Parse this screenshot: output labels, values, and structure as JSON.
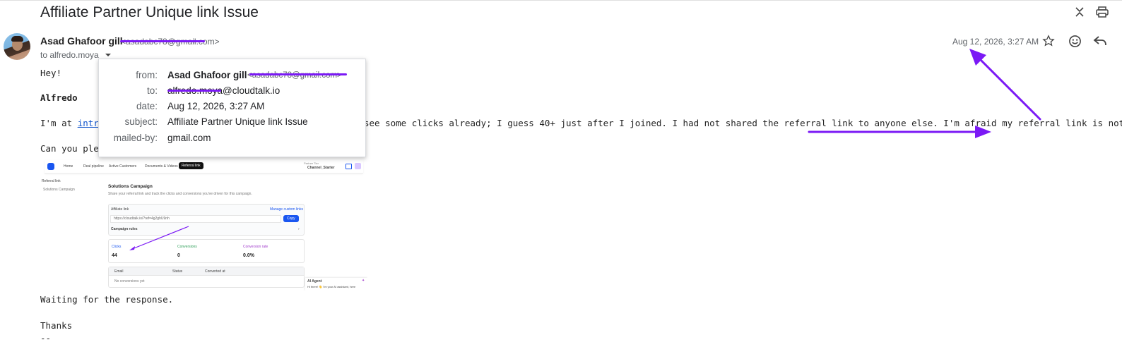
{
  "email": {
    "subject": "Affiliate Partner Unique link Issue",
    "sender_name": "Asad Ghafoor gill",
    "sender_email": "<asadabc78@gmail.com>",
    "to_line": "to alfredo.moya",
    "date": "Aug 12, 2026, 3:27 AM"
  },
  "details_popup": {
    "from_label": "from:",
    "from_name": "Asad Ghafoor gill",
    "from_email": "<asadabc78@gmail.com>",
    "to_label": "to:",
    "to_user": "alfredo.moya",
    "to_domain": "@cloudtalk.io",
    "date_label": "date:",
    "date_value": "Aug 12, 2026, 3:27 AM",
    "subject_label": "subject:",
    "subject_value": "Affiliate Partner Unique link Issue",
    "mailed_by_label": "mailed-by:",
    "mailed_by_value": "gmail.com"
  },
  "body": {
    "greeting": "Hey!",
    "name": "Alfredo",
    "para1_prefix": "I'm at ",
    "para1_link": "introw.",
    "para1_suffix": "see some clicks already; I guess 40+ just after I joined. I had not shared the referral link to anyone else. I'm afraid my referral link is not unique.",
    "para2_prefix": "Can you pleas",
    "waiting": "Waiting for the response.",
    "thanks": "Thanks",
    "sig": "--"
  },
  "embedded_screenshot": {
    "nav": [
      "Home",
      "Deal pipeline",
      "Active Customers",
      "Documents & Videos",
      "Referral link"
    ],
    "active_nav": "Referral link",
    "partner_label": "Partner Tier",
    "partner_name": "Channel_Starter",
    "sidebar_title": "Referral link",
    "sidebar_item": "Solutions Campaign",
    "campaign_title": "Solutions Campaign",
    "campaign_desc": "Share your referral link and track the clicks and conversions you've driven for this campaign.",
    "affiliate_link_label": "Affiliate link",
    "manage_links": "Manage custom links",
    "link_value": "https://cloudtalk.io/?ref=4g2ghU9nh",
    "copy_label": "Copy",
    "campaign_rules": "Campaign rules",
    "stats": [
      {
        "label": "Clicks",
        "value": "44"
      },
      {
        "label": "Conversions",
        "value": "0"
      },
      {
        "label": "Conversion rate",
        "value": "0.0%"
      }
    ],
    "table_headers": [
      "Email",
      "Status",
      "Converted at"
    ],
    "empty_text": "No conversions yet",
    "ai_title": "AI Agent",
    "ai_text": "Hi there! 👋 I'm your AI assistant, here"
  },
  "colors": {
    "annotation": "#7b19f5",
    "link": "#1155cc",
    "accent": "#1a56f0"
  },
  "icons": [
    "close-icon",
    "print-icon",
    "star-icon",
    "emoji-icon",
    "reply-icon",
    "chevron-down-icon"
  ]
}
